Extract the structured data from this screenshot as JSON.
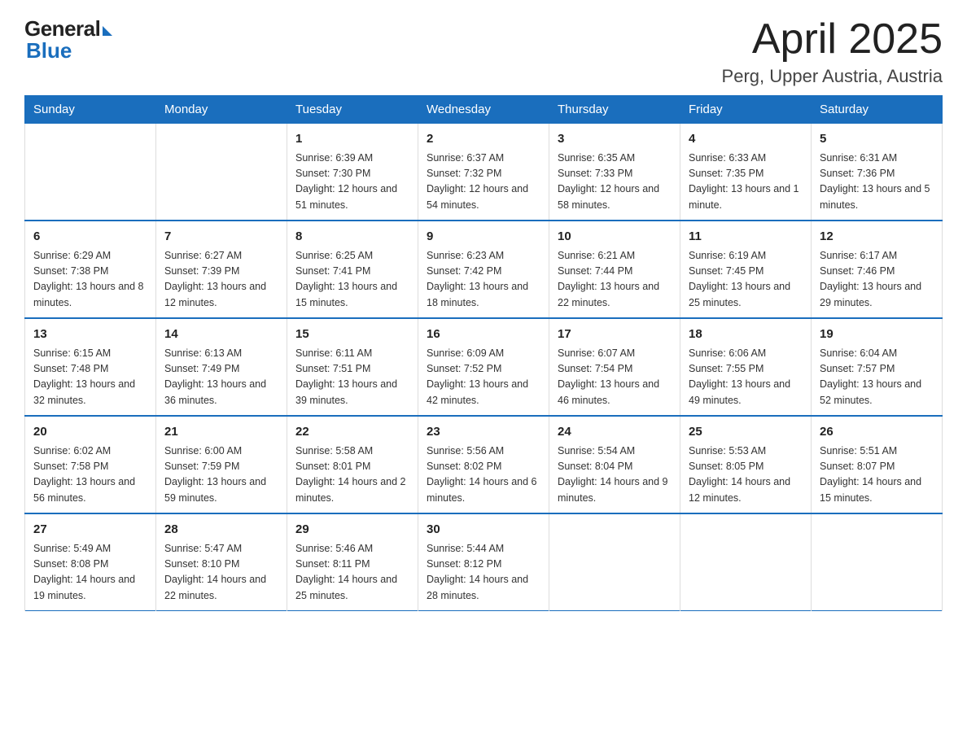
{
  "logo": {
    "general": "General",
    "blue": "Blue"
  },
  "title": "April 2025",
  "subtitle": "Perg, Upper Austria, Austria",
  "weekdays": [
    "Sunday",
    "Monday",
    "Tuesday",
    "Wednesday",
    "Thursday",
    "Friday",
    "Saturday"
  ],
  "weeks": [
    [
      {
        "day": "",
        "info": ""
      },
      {
        "day": "",
        "info": ""
      },
      {
        "day": "1",
        "info": "Sunrise: 6:39 AM\nSunset: 7:30 PM\nDaylight: 12 hours\nand 51 minutes."
      },
      {
        "day": "2",
        "info": "Sunrise: 6:37 AM\nSunset: 7:32 PM\nDaylight: 12 hours\nand 54 minutes."
      },
      {
        "day": "3",
        "info": "Sunrise: 6:35 AM\nSunset: 7:33 PM\nDaylight: 12 hours\nand 58 minutes."
      },
      {
        "day": "4",
        "info": "Sunrise: 6:33 AM\nSunset: 7:35 PM\nDaylight: 13 hours\nand 1 minute."
      },
      {
        "day": "5",
        "info": "Sunrise: 6:31 AM\nSunset: 7:36 PM\nDaylight: 13 hours\nand 5 minutes."
      }
    ],
    [
      {
        "day": "6",
        "info": "Sunrise: 6:29 AM\nSunset: 7:38 PM\nDaylight: 13 hours\nand 8 minutes."
      },
      {
        "day": "7",
        "info": "Sunrise: 6:27 AM\nSunset: 7:39 PM\nDaylight: 13 hours\nand 12 minutes."
      },
      {
        "day": "8",
        "info": "Sunrise: 6:25 AM\nSunset: 7:41 PM\nDaylight: 13 hours\nand 15 minutes."
      },
      {
        "day": "9",
        "info": "Sunrise: 6:23 AM\nSunset: 7:42 PM\nDaylight: 13 hours\nand 18 minutes."
      },
      {
        "day": "10",
        "info": "Sunrise: 6:21 AM\nSunset: 7:44 PM\nDaylight: 13 hours\nand 22 minutes."
      },
      {
        "day": "11",
        "info": "Sunrise: 6:19 AM\nSunset: 7:45 PM\nDaylight: 13 hours\nand 25 minutes."
      },
      {
        "day": "12",
        "info": "Sunrise: 6:17 AM\nSunset: 7:46 PM\nDaylight: 13 hours\nand 29 minutes."
      }
    ],
    [
      {
        "day": "13",
        "info": "Sunrise: 6:15 AM\nSunset: 7:48 PM\nDaylight: 13 hours\nand 32 minutes."
      },
      {
        "day": "14",
        "info": "Sunrise: 6:13 AM\nSunset: 7:49 PM\nDaylight: 13 hours\nand 36 minutes."
      },
      {
        "day": "15",
        "info": "Sunrise: 6:11 AM\nSunset: 7:51 PM\nDaylight: 13 hours\nand 39 minutes."
      },
      {
        "day": "16",
        "info": "Sunrise: 6:09 AM\nSunset: 7:52 PM\nDaylight: 13 hours\nand 42 minutes."
      },
      {
        "day": "17",
        "info": "Sunrise: 6:07 AM\nSunset: 7:54 PM\nDaylight: 13 hours\nand 46 minutes."
      },
      {
        "day": "18",
        "info": "Sunrise: 6:06 AM\nSunset: 7:55 PM\nDaylight: 13 hours\nand 49 minutes."
      },
      {
        "day": "19",
        "info": "Sunrise: 6:04 AM\nSunset: 7:57 PM\nDaylight: 13 hours\nand 52 minutes."
      }
    ],
    [
      {
        "day": "20",
        "info": "Sunrise: 6:02 AM\nSunset: 7:58 PM\nDaylight: 13 hours\nand 56 minutes."
      },
      {
        "day": "21",
        "info": "Sunrise: 6:00 AM\nSunset: 7:59 PM\nDaylight: 13 hours\nand 59 minutes."
      },
      {
        "day": "22",
        "info": "Sunrise: 5:58 AM\nSunset: 8:01 PM\nDaylight: 14 hours\nand 2 minutes."
      },
      {
        "day": "23",
        "info": "Sunrise: 5:56 AM\nSunset: 8:02 PM\nDaylight: 14 hours\nand 6 minutes."
      },
      {
        "day": "24",
        "info": "Sunrise: 5:54 AM\nSunset: 8:04 PM\nDaylight: 14 hours\nand 9 minutes."
      },
      {
        "day": "25",
        "info": "Sunrise: 5:53 AM\nSunset: 8:05 PM\nDaylight: 14 hours\nand 12 minutes."
      },
      {
        "day": "26",
        "info": "Sunrise: 5:51 AM\nSunset: 8:07 PM\nDaylight: 14 hours\nand 15 minutes."
      }
    ],
    [
      {
        "day": "27",
        "info": "Sunrise: 5:49 AM\nSunset: 8:08 PM\nDaylight: 14 hours\nand 19 minutes."
      },
      {
        "day": "28",
        "info": "Sunrise: 5:47 AM\nSunset: 8:10 PM\nDaylight: 14 hours\nand 22 minutes."
      },
      {
        "day": "29",
        "info": "Sunrise: 5:46 AM\nSunset: 8:11 PM\nDaylight: 14 hours\nand 25 minutes."
      },
      {
        "day": "30",
        "info": "Sunrise: 5:44 AM\nSunset: 8:12 PM\nDaylight: 14 hours\nand 28 minutes."
      },
      {
        "day": "",
        "info": ""
      },
      {
        "day": "",
        "info": ""
      },
      {
        "day": "",
        "info": ""
      }
    ]
  ]
}
